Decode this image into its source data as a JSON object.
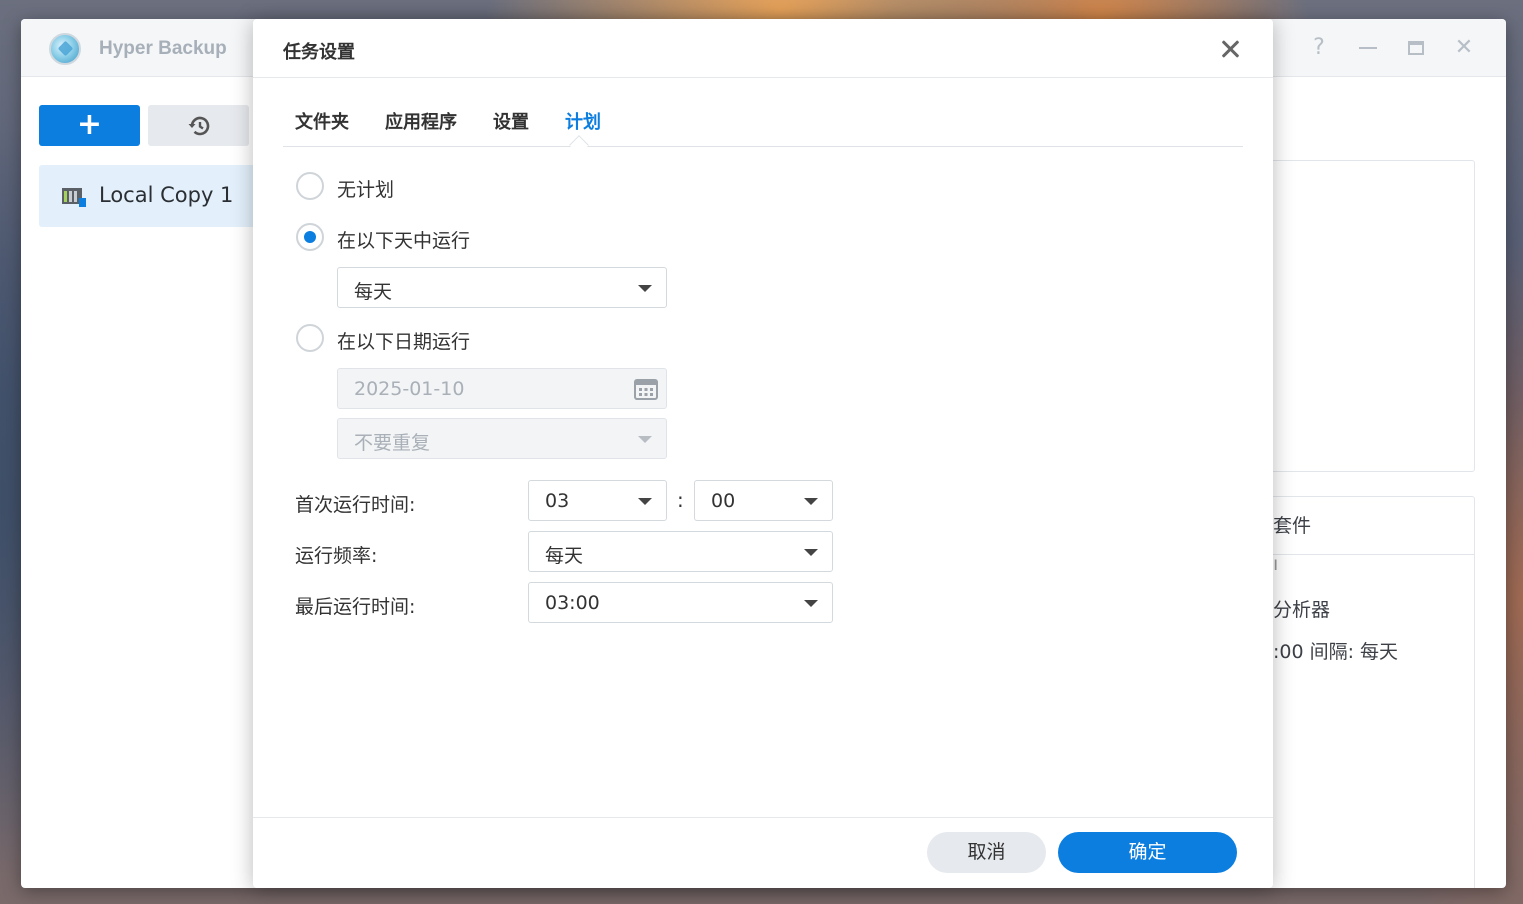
{
  "app": {
    "title": "Hyper Backup",
    "add_button": "+",
    "task_name": "Local Copy 1",
    "background_texts": [
      "套件",
      "ı",
      "分析器",
      ":00 间隔: 每天"
    ]
  },
  "dialog": {
    "title": "任务设置",
    "tabs": [
      "文件夹",
      "应用程序",
      "设置",
      "计划"
    ],
    "active_tab": "计划",
    "schedule": {
      "option_none": "无计划",
      "option_days": "在以下天中运行",
      "days_value": "每天",
      "option_date": "在以下日期运行",
      "date_value": "2025-01-10",
      "repeat_value": "不要重复",
      "selected_option": "在以下天中运行"
    },
    "time": {
      "first_run_label": "首次运行时间:",
      "hour": "03",
      "separator": ":",
      "minute": "00",
      "frequency_label": "运行频率:",
      "frequency": "每天",
      "last_run_label": "最后运行时间:",
      "last_run": "03:00"
    },
    "buttons": {
      "cancel": "取消",
      "ok": "确定"
    }
  },
  "colors": {
    "accent": "#0b7ee0",
    "selected_row": "#e3f0fc"
  }
}
